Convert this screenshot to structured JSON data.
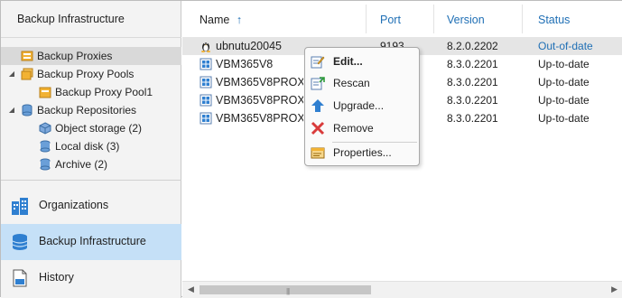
{
  "left": {
    "title": "Backup Infrastructure",
    "tree": [
      {
        "label": "Backup Proxies",
        "expander": "",
        "icon": "proxy-server-icon",
        "selected": true
      },
      {
        "label": "Backup Proxy Pools",
        "expander": "◢",
        "icon": "proxy-pools-icon"
      },
      {
        "label": "Backup Proxy Pool1",
        "expander": "",
        "icon": "proxy-pool-icon"
      },
      {
        "label": "Backup Repositories",
        "expander": "◢",
        "icon": "repositories-icon"
      },
      {
        "label": "Object storage (2)",
        "expander": "",
        "icon": "object-storage-icon"
      },
      {
        "label": "Local disk (3)",
        "expander": "",
        "icon": "local-disk-icon"
      },
      {
        "label": "Archive (2)",
        "expander": "",
        "icon": "archive-icon"
      }
    ],
    "nav": [
      {
        "label": "Organizations",
        "icon": "organizations-icon"
      },
      {
        "label": "Backup Infrastructure",
        "icon": "backup-infrastructure-icon",
        "active": true
      },
      {
        "label": "History",
        "icon": "history-icon"
      }
    ]
  },
  "table": {
    "columns": {
      "name": "Name",
      "sort_icon": "↑",
      "port": "Port",
      "version": "Version",
      "status": "Status"
    },
    "rows": [
      {
        "name": "ubnutu20045",
        "port": "9193",
        "version": "8.2.0.2202",
        "status": "Out-of-date",
        "icon": "linux-icon"
      },
      {
        "name": "VBM365V8",
        "port": "",
        "version": "8.3.0.2201",
        "status": "Up-to-date",
        "icon": "windows-server-icon"
      },
      {
        "name": "VBM365V8PROXY01",
        "port": "",
        "version": "8.3.0.2201",
        "status": "Up-to-date",
        "icon": "windows-server-icon"
      },
      {
        "name": "VBM365V8PROXY02",
        "port": "",
        "version": "8.3.0.2201",
        "status": "Up-to-date",
        "icon": "windows-server-icon"
      },
      {
        "name": "VBM365V8PROXY03",
        "port": "",
        "version": "8.3.0.2201",
        "status": "Up-to-date",
        "icon": "windows-server-icon"
      }
    ]
  },
  "context_menu": {
    "items": [
      {
        "label": "Edit...",
        "icon": "edit-icon",
        "bold": true
      },
      {
        "label": "Rescan",
        "icon": "rescan-icon"
      },
      {
        "label": "Upgrade...",
        "icon": "upgrade-icon"
      },
      {
        "label": "Remove",
        "icon": "remove-icon"
      },
      {
        "label": "Properties...",
        "icon": "properties-icon"
      }
    ]
  },
  "colors": {
    "accent": "#1f6fb5",
    "nav_active": "#c5e0f7",
    "remove": "#d93b3b"
  }
}
